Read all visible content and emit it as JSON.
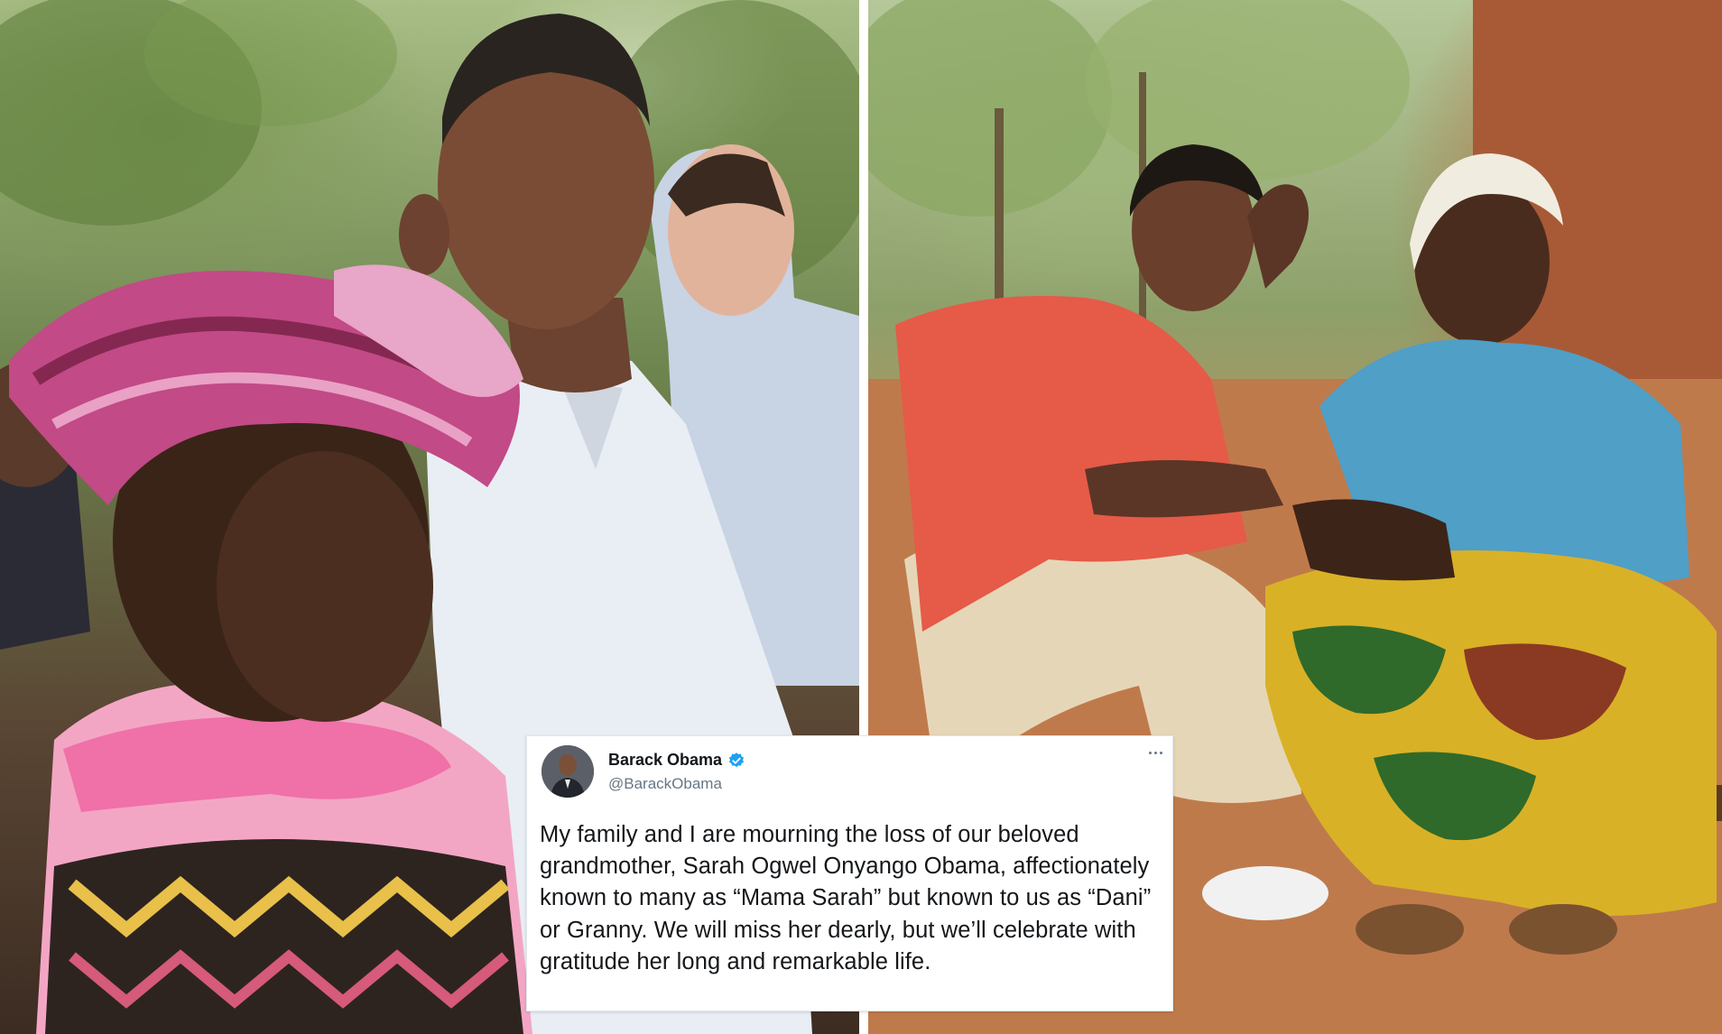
{
  "images": {
    "left_photo": {
      "icon": "photo-obama-with-grandmother-headscarf"
    },
    "right_photo": {
      "icon": "photo-young-obama-with-grandmother-seated"
    }
  },
  "tweet": {
    "author_name": "Barack Obama",
    "handle": "@BarackObama",
    "verified_icon": "verified-badge-icon",
    "more_icon": "more-options-icon",
    "text": "My family and I are mourning the loss of our beloved grandmother, Sarah Ogwel Onyango Obama, affectionately known to many as “Mama Sarah” but known to us as “Dani” or Granny. We will miss her dearly, but we’ll celebrate with gratitude her long and remarkable life."
  },
  "colors": {
    "verified_blue": "#1da1f2",
    "text_primary": "#14171a",
    "text_secondary": "#657786"
  }
}
